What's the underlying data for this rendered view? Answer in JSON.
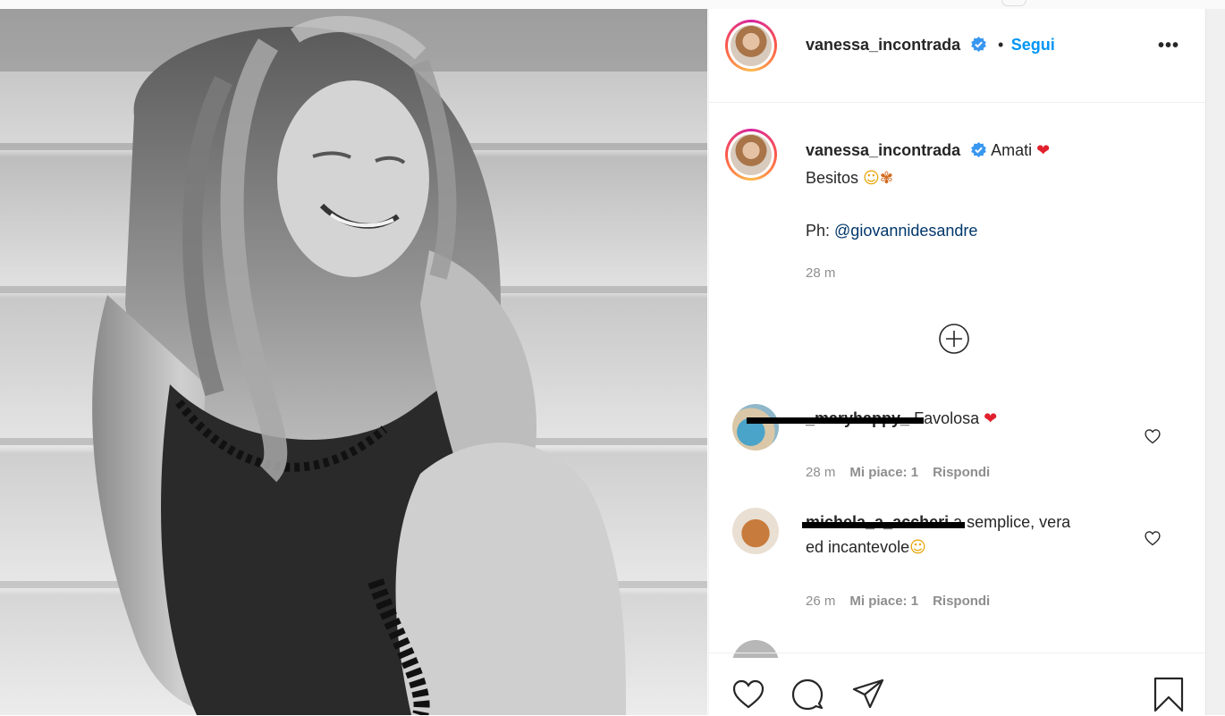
{
  "post": {
    "username": "vanessa_incontrada",
    "follow_label": "Segui",
    "more_label": "•••",
    "caption_text": "Amati",
    "caption_line2": "Besitos",
    "credit_prefix": "Ph: ",
    "credit_mention": "@giovannidesandre",
    "time_ago": "28 m"
  },
  "comments": [
    {
      "username": "_maryhappy_",
      "text": "Favolosa",
      "time": "28 m",
      "likes_label": "Mi piace: 1",
      "reply_label": "Rispondi"
    },
    {
      "username": "michela_a_accheri",
      "text": "a semplice, vera",
      "text_line2": "ed incantevole",
      "time": "26 m",
      "likes_label": "Mi piace: 1",
      "reply_label": "Rispondi"
    }
  ],
  "icons": {
    "verified": "verified-badge-icon",
    "heart": "heart-icon",
    "comment": "comment-icon",
    "share": "share-icon",
    "save": "bookmark-icon",
    "add": "add-circle-icon",
    "more": "more-options-icon"
  },
  "colors": {
    "link": "#0095f6",
    "mention": "#00376b",
    "muted": "#8e8e8e",
    "heart": "#e0202c"
  }
}
